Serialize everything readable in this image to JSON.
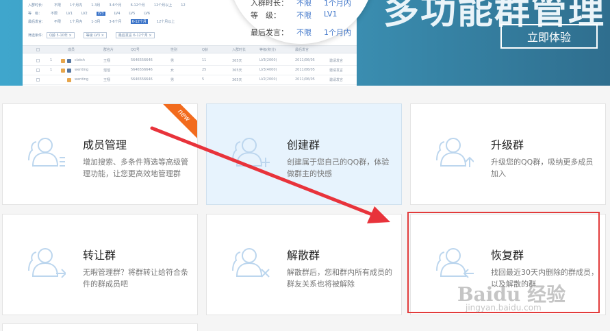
{
  "banner": {
    "title_partial": "多功能群管理",
    "cta_label": "立即体验",
    "filter_popup": {
      "row_top": {
        "label": "入群时长：",
        "v1": "不限",
        "v2": "1个月内"
      },
      "level": {
        "label": "等　级：",
        "v1": "不限",
        "v2": "LV1"
      },
      "last_speak": {
        "label": "最后发言：",
        "v1": "不限",
        "v2": "1个月内"
      }
    },
    "mock": {
      "row1": [
        "入群时长：",
        "不限",
        "1个月内",
        "1-3月",
        "3-6个月",
        "6-12个月",
        "12个月以上",
        "12"
      ],
      "row2": [
        "等　级：",
        "不限",
        "LV1",
        "LV2",
        "LV3",
        "LV4",
        "LV5",
        "LV6"
      ],
      "row3": [
        "最后发言：",
        "不限",
        "1个月内",
        "1-3月",
        "3-6个月",
        "6-12个月",
        "12个月以上"
      ],
      "filters_label": "筛选条件：",
      "chips": [
        "Q龄 5-10年 ×",
        "等级 LV3 ×",
        "最后发言 6-12个月 ×"
      ],
      "headers": [
        "成员",
        "群名片",
        "QQ号",
        "性别",
        "Q龄",
        "入群时长",
        "等级(积分)",
        "最后发言"
      ],
      "rows": [
        [
          "1",
          "clatsh",
          "王翔",
          "5646556646",
          "男",
          "11",
          "365天",
          "LV3(2000)",
          "2011/06/05",
          "邀请发言"
        ],
        [
          "1",
          "wenting",
          "溜溜",
          "5646556646",
          "女",
          "25",
          "365天",
          "LV3(4000)",
          "2011/06/05",
          "邀请发言"
        ],
        [
          "",
          "wenting",
          "王翔",
          "5646556646",
          "男",
          "5",
          "365天",
          "LV2(2000)",
          "2011/06/05",
          "邀请发言"
        ]
      ]
    }
  },
  "cards": [
    {
      "title": "成员管理",
      "desc": "增加搜索、多条件筛选等高级管理功能，让您更高效地管理群",
      "icon": "members-list-icon",
      "badge": "new"
    },
    {
      "title": "创建群",
      "desc": "创建属于您自己的QQ群，体验做群主的快感",
      "icon": "members-add-icon"
    },
    {
      "title": "升级群",
      "desc": "升级您的QQ群，吸纳更多成员加入",
      "icon": "members-upgrade-icon"
    },
    {
      "title": "转让群",
      "desc": "无暇管理群？将群转让给符合条件的群成员吧",
      "icon": "members-transfer-icon"
    },
    {
      "title": "解散群",
      "desc": "解散群后，您和群内所有成员的群友关系也将被解除",
      "icon": "members-dismiss-icon"
    },
    {
      "title": "恢复群",
      "desc": "找回最近30天内删除的群成员，以及解散的群",
      "icon": "members-restore-icon"
    }
  ],
  "watermark": {
    "main": "Baidu 经验",
    "sub": "jingyan.baidu.com"
  },
  "colors": {
    "accent": "#3d74c9",
    "banner": "#3b90b3",
    "ribbon": "#f26b1d",
    "highlight": "#e23b3b",
    "arrow": "#e8333b",
    "icon": "#bcd6ee"
  }
}
